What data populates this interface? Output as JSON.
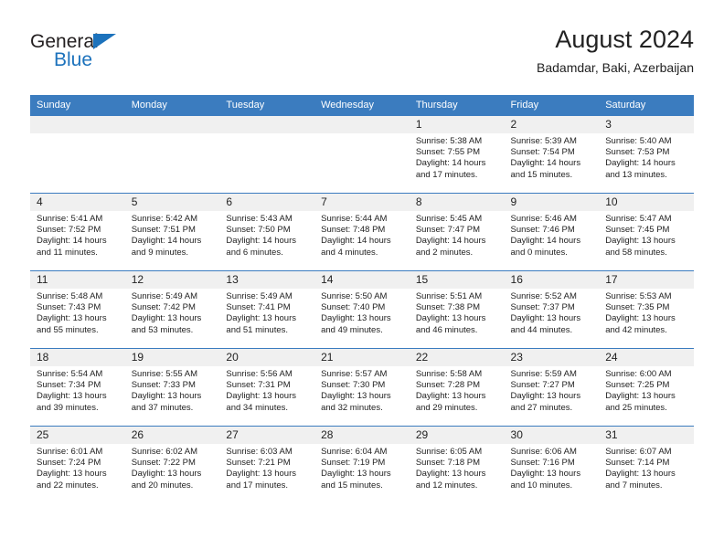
{
  "brand": {
    "name_part1": "General",
    "name_part2": "Blue",
    "logo_icon": "blue-triangle-icon",
    "accent_color": "#1c72bc"
  },
  "header": {
    "title": "August 2024",
    "subtitle": "Badamdar, Baki, Azerbaijan"
  },
  "theme": {
    "header_blue": "#3b7cbf",
    "daynum_band": "#f0f0f0",
    "text": "#222222"
  },
  "weekday_headers": [
    "Sunday",
    "Monday",
    "Tuesday",
    "Wednesday",
    "Thursday",
    "Friday",
    "Saturday"
  ],
  "labels": {
    "sunrise_prefix": "Sunrise:",
    "sunset_prefix": "Sunset:",
    "daylight_prefix": "Daylight:"
  },
  "weeks": [
    [
      {
        "day": "",
        "sunrise": "",
        "sunset": "",
        "daylight_line1": "",
        "daylight_line2": ""
      },
      {
        "day": "",
        "sunrise": "",
        "sunset": "",
        "daylight_line1": "",
        "daylight_line2": ""
      },
      {
        "day": "",
        "sunrise": "",
        "sunset": "",
        "daylight_line1": "",
        "daylight_line2": ""
      },
      {
        "day": "",
        "sunrise": "",
        "sunset": "",
        "daylight_line1": "",
        "daylight_line2": ""
      },
      {
        "day": "1",
        "sunrise": "Sunrise: 5:38 AM",
        "sunset": "Sunset: 7:55 PM",
        "daylight_line1": "Daylight: 14 hours",
        "daylight_line2": "and 17 minutes."
      },
      {
        "day": "2",
        "sunrise": "Sunrise: 5:39 AM",
        "sunset": "Sunset: 7:54 PM",
        "daylight_line1": "Daylight: 14 hours",
        "daylight_line2": "and 15 minutes."
      },
      {
        "day": "3",
        "sunrise": "Sunrise: 5:40 AM",
        "sunset": "Sunset: 7:53 PM",
        "daylight_line1": "Daylight: 14 hours",
        "daylight_line2": "and 13 minutes."
      }
    ],
    [
      {
        "day": "4",
        "sunrise": "Sunrise: 5:41 AM",
        "sunset": "Sunset: 7:52 PM",
        "daylight_line1": "Daylight: 14 hours",
        "daylight_line2": "and 11 minutes."
      },
      {
        "day": "5",
        "sunrise": "Sunrise: 5:42 AM",
        "sunset": "Sunset: 7:51 PM",
        "daylight_line1": "Daylight: 14 hours",
        "daylight_line2": "and 9 minutes."
      },
      {
        "day": "6",
        "sunrise": "Sunrise: 5:43 AM",
        "sunset": "Sunset: 7:50 PM",
        "daylight_line1": "Daylight: 14 hours",
        "daylight_line2": "and 6 minutes."
      },
      {
        "day": "7",
        "sunrise": "Sunrise: 5:44 AM",
        "sunset": "Sunset: 7:48 PM",
        "daylight_line1": "Daylight: 14 hours",
        "daylight_line2": "and 4 minutes."
      },
      {
        "day": "8",
        "sunrise": "Sunrise: 5:45 AM",
        "sunset": "Sunset: 7:47 PM",
        "daylight_line1": "Daylight: 14 hours",
        "daylight_line2": "and 2 minutes."
      },
      {
        "day": "9",
        "sunrise": "Sunrise: 5:46 AM",
        "sunset": "Sunset: 7:46 PM",
        "daylight_line1": "Daylight: 14 hours",
        "daylight_line2": "and 0 minutes."
      },
      {
        "day": "10",
        "sunrise": "Sunrise: 5:47 AM",
        "sunset": "Sunset: 7:45 PM",
        "daylight_line1": "Daylight: 13 hours",
        "daylight_line2": "and 58 minutes."
      }
    ],
    [
      {
        "day": "11",
        "sunrise": "Sunrise: 5:48 AM",
        "sunset": "Sunset: 7:43 PM",
        "daylight_line1": "Daylight: 13 hours",
        "daylight_line2": "and 55 minutes."
      },
      {
        "day": "12",
        "sunrise": "Sunrise: 5:49 AM",
        "sunset": "Sunset: 7:42 PM",
        "daylight_line1": "Daylight: 13 hours",
        "daylight_line2": "and 53 minutes."
      },
      {
        "day": "13",
        "sunrise": "Sunrise: 5:49 AM",
        "sunset": "Sunset: 7:41 PM",
        "daylight_line1": "Daylight: 13 hours",
        "daylight_line2": "and 51 minutes."
      },
      {
        "day": "14",
        "sunrise": "Sunrise: 5:50 AM",
        "sunset": "Sunset: 7:40 PM",
        "daylight_line1": "Daylight: 13 hours",
        "daylight_line2": "and 49 minutes."
      },
      {
        "day": "15",
        "sunrise": "Sunrise: 5:51 AM",
        "sunset": "Sunset: 7:38 PM",
        "daylight_line1": "Daylight: 13 hours",
        "daylight_line2": "and 46 minutes."
      },
      {
        "day": "16",
        "sunrise": "Sunrise: 5:52 AM",
        "sunset": "Sunset: 7:37 PM",
        "daylight_line1": "Daylight: 13 hours",
        "daylight_line2": "and 44 minutes."
      },
      {
        "day": "17",
        "sunrise": "Sunrise: 5:53 AM",
        "sunset": "Sunset: 7:35 PM",
        "daylight_line1": "Daylight: 13 hours",
        "daylight_line2": "and 42 minutes."
      }
    ],
    [
      {
        "day": "18",
        "sunrise": "Sunrise: 5:54 AM",
        "sunset": "Sunset: 7:34 PM",
        "daylight_line1": "Daylight: 13 hours",
        "daylight_line2": "and 39 minutes."
      },
      {
        "day": "19",
        "sunrise": "Sunrise: 5:55 AM",
        "sunset": "Sunset: 7:33 PM",
        "daylight_line1": "Daylight: 13 hours",
        "daylight_line2": "and 37 minutes."
      },
      {
        "day": "20",
        "sunrise": "Sunrise: 5:56 AM",
        "sunset": "Sunset: 7:31 PM",
        "daylight_line1": "Daylight: 13 hours",
        "daylight_line2": "and 34 minutes."
      },
      {
        "day": "21",
        "sunrise": "Sunrise: 5:57 AM",
        "sunset": "Sunset: 7:30 PM",
        "daylight_line1": "Daylight: 13 hours",
        "daylight_line2": "and 32 minutes."
      },
      {
        "day": "22",
        "sunrise": "Sunrise: 5:58 AM",
        "sunset": "Sunset: 7:28 PM",
        "daylight_line1": "Daylight: 13 hours",
        "daylight_line2": "and 29 minutes."
      },
      {
        "day": "23",
        "sunrise": "Sunrise: 5:59 AM",
        "sunset": "Sunset: 7:27 PM",
        "daylight_line1": "Daylight: 13 hours",
        "daylight_line2": "and 27 minutes."
      },
      {
        "day": "24",
        "sunrise": "Sunrise: 6:00 AM",
        "sunset": "Sunset: 7:25 PM",
        "daylight_line1": "Daylight: 13 hours",
        "daylight_line2": "and 25 minutes."
      }
    ],
    [
      {
        "day": "25",
        "sunrise": "Sunrise: 6:01 AM",
        "sunset": "Sunset: 7:24 PM",
        "daylight_line1": "Daylight: 13 hours",
        "daylight_line2": "and 22 minutes."
      },
      {
        "day": "26",
        "sunrise": "Sunrise: 6:02 AM",
        "sunset": "Sunset: 7:22 PM",
        "daylight_line1": "Daylight: 13 hours",
        "daylight_line2": "and 20 minutes."
      },
      {
        "day": "27",
        "sunrise": "Sunrise: 6:03 AM",
        "sunset": "Sunset: 7:21 PM",
        "daylight_line1": "Daylight: 13 hours",
        "daylight_line2": "and 17 minutes."
      },
      {
        "day": "28",
        "sunrise": "Sunrise: 6:04 AM",
        "sunset": "Sunset: 7:19 PM",
        "daylight_line1": "Daylight: 13 hours",
        "daylight_line2": "and 15 minutes."
      },
      {
        "day": "29",
        "sunrise": "Sunrise: 6:05 AM",
        "sunset": "Sunset: 7:18 PM",
        "daylight_line1": "Daylight: 13 hours",
        "daylight_line2": "and 12 minutes."
      },
      {
        "day": "30",
        "sunrise": "Sunrise: 6:06 AM",
        "sunset": "Sunset: 7:16 PM",
        "daylight_line1": "Daylight: 13 hours",
        "daylight_line2": "and 10 minutes."
      },
      {
        "day": "31",
        "sunrise": "Sunrise: 6:07 AM",
        "sunset": "Sunset: 7:14 PM",
        "daylight_line1": "Daylight: 13 hours",
        "daylight_line2": "and 7 minutes."
      }
    ]
  ]
}
